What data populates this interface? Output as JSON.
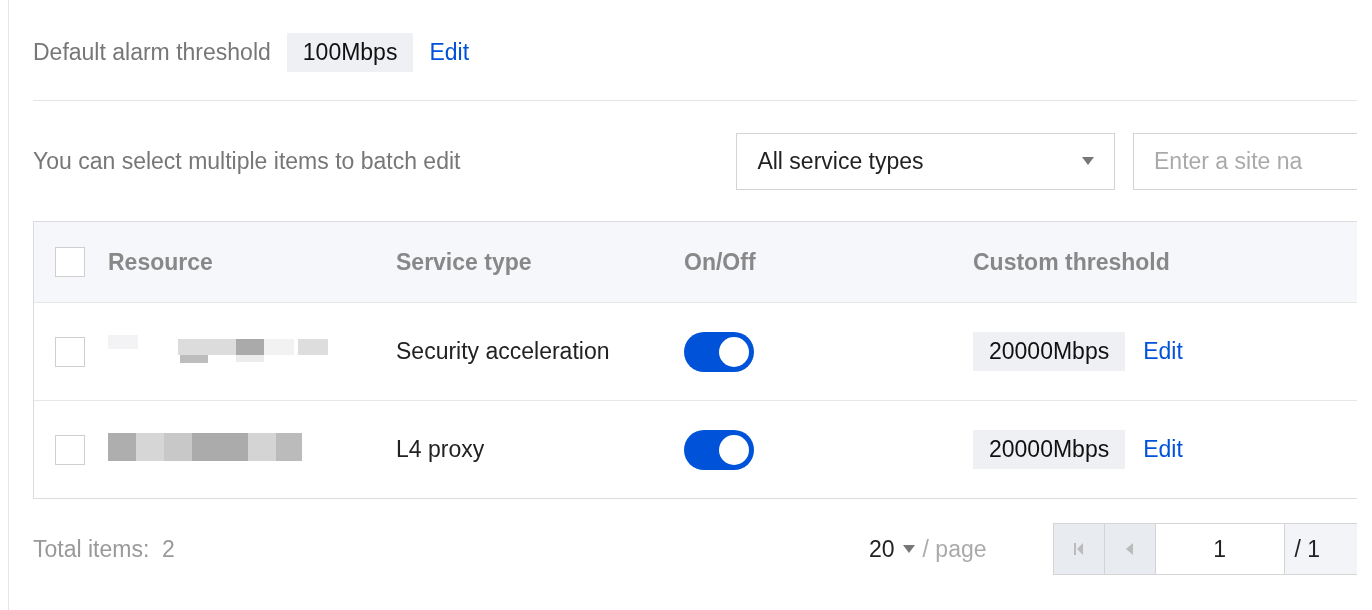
{
  "default_threshold": {
    "label": "Default alarm threshold",
    "value": "100Mbps",
    "edit": "Edit"
  },
  "toolbar": {
    "hint": "You can select multiple items to batch edit",
    "service_filter": "All service types",
    "search": {
      "placeholder": "Enter a site na"
    }
  },
  "table": {
    "select_all": false,
    "columns": [
      "Resource",
      "Service type",
      "On/Off",
      "Custom threshold"
    ],
    "rows": [
      {
        "checked": false,
        "service_type": "Security acceleration",
        "on": true,
        "threshold": "20000Mbps",
        "edit": "Edit"
      },
      {
        "checked": false,
        "service_type": "L4 proxy",
        "on": true,
        "threshold": "20000Mbps",
        "edit": "Edit"
      }
    ]
  },
  "footer": {
    "total": "Total items:  2",
    "page_size": "20",
    "per_page": "/ page",
    "page": "1",
    "page_count": "/ 1"
  }
}
